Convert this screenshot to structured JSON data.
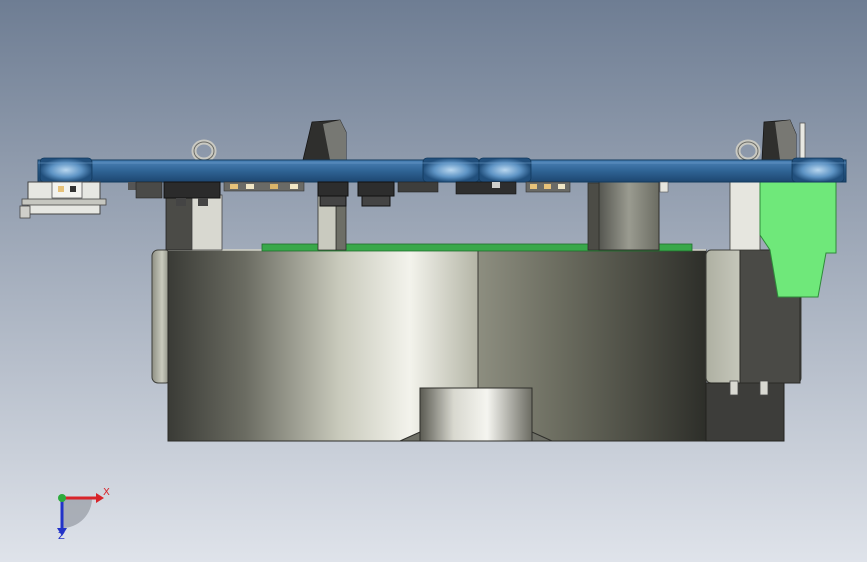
{
  "window": {
    "title": ""
  },
  "viewport": {
    "background_top": "#6e7d93",
    "background_bottom": "#dfe3ea"
  },
  "colors": {
    "pcb_blue": "#2f6394",
    "pcb_green": "#38a84a",
    "mount_green": "#6fe87a",
    "metal_light": "#f0f0ea",
    "metal_dark": "#3b3b3b",
    "axis_x": "#d8242a",
    "axis_y": "#2dab3c",
    "axis_z": "#2233c8"
  },
  "triad": {
    "x_label": "X",
    "z_label": "Z",
    "icons": [
      "axis-x-arrow-icon",
      "axis-y-dot-icon",
      "axis-z-arrow-icon"
    ]
  }
}
